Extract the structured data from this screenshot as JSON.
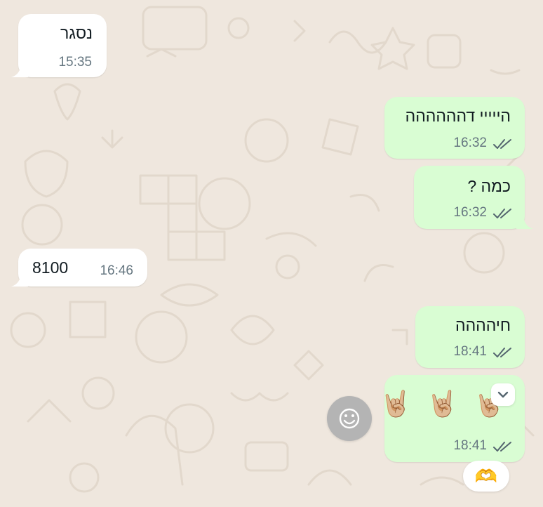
{
  "messages": [
    {
      "direction": "incoming",
      "text": "נסגר",
      "time": "15:35"
    },
    {
      "direction": "outgoing",
      "text": "הייייי דהההההה",
      "time": "16:32",
      "status_icon": "double-check-icon"
    },
    {
      "direction": "outgoing",
      "text": "כמה ?",
      "time": "16:32",
      "status_icon": "double-check-icon"
    },
    {
      "direction": "incoming",
      "text": "8100",
      "time": "16:46"
    },
    {
      "direction": "outgoing",
      "text": "חיהההה",
      "time": "18:41",
      "status_icon": "double-check-icon"
    },
    {
      "direction": "outgoing",
      "text": "🤘🏼 🤘🏼 🤘🏼",
      "time": "18:41",
      "status_icon": "double-check-icon"
    }
  ],
  "reaction": {
    "emoji": "🫶"
  },
  "controls": {
    "message_menu_icon": "chevron-down-icon",
    "react_icon": "smiley-icon"
  },
  "colors": {
    "wallpaper": "#efe7de",
    "incoming_bubble": "#ffffff",
    "outgoing_bubble": "#d9fdd3",
    "text": "#111b21",
    "meta": "#667781"
  }
}
